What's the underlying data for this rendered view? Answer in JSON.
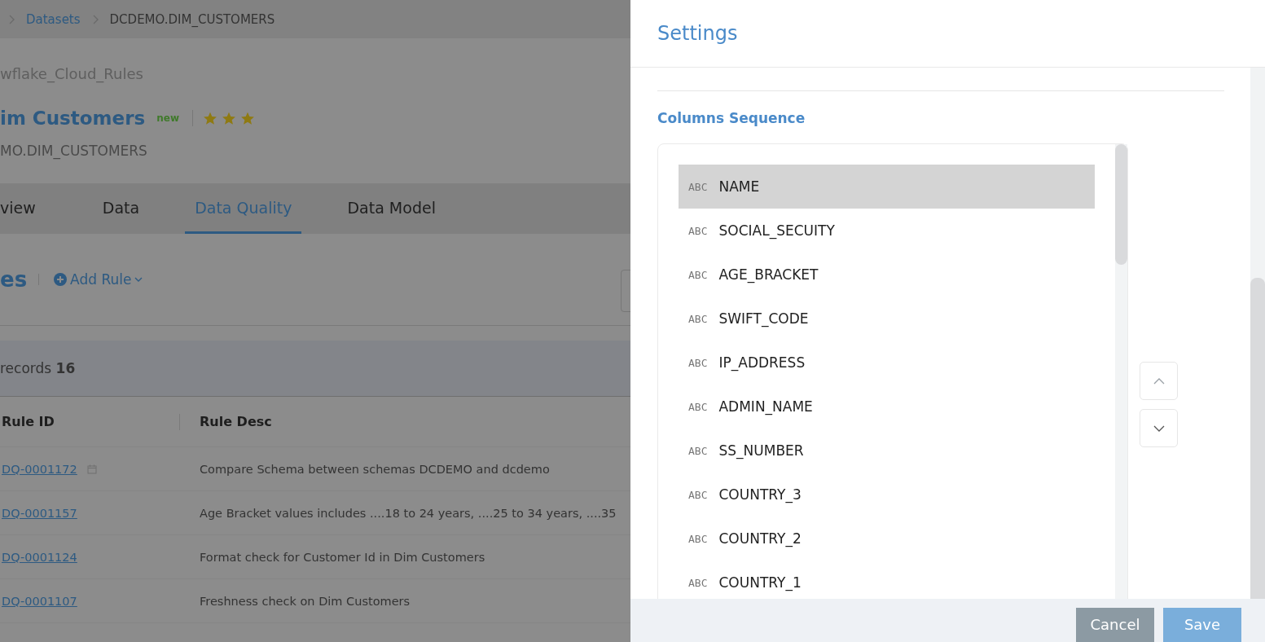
{
  "breadcrumb": [
    {
      "label": "Datasets",
      "link": true
    },
    {
      "label": "DCDEMO.DIM_CUSTOMERS",
      "link": false
    }
  ],
  "header": {
    "source": "wflake_Cloud_Rules",
    "title": "im Customers",
    "badge": "new",
    "stars": 3,
    "subtitle": "MO.DIM_CUSTOMERS"
  },
  "tabs": [
    {
      "label": "view",
      "selected": false
    },
    {
      "label": "Data",
      "selected": false
    },
    {
      "label": "Data Quality",
      "selected": true
    },
    {
      "label": "Data Model",
      "selected": false
    }
  ],
  "rules_bar": {
    "title": "es",
    "add_button": "Add Rule"
  },
  "records": "records **16**",
  "table": {
    "columns": [
      "Rule ID",
      "Rule Desc"
    ],
    "rows": [
      {
        "id": "DQ-0001172",
        "calendar": true,
        "desc": "Compare Schema between schemas DCDEMO and dcdemo"
      },
      {
        "id": "DQ-0001157",
        "calendar": false,
        "desc": "Age Bracket values includes ....18 to 24 years, ....25 to 34 years, ....35"
      },
      {
        "id": "DQ-0001124",
        "calendar": false,
        "desc": "Format check for Customer Id in Dim Customers"
      },
      {
        "id": "DQ-0001107",
        "calendar": false,
        "desc": "Freshness check on Dim Customers"
      }
    ]
  },
  "settings": {
    "title": "Settings",
    "section": "Columns Sequence",
    "columns": [
      {
        "type": "ABC",
        "name": "NAME",
        "selected": true
      },
      {
        "type": "ABC",
        "name": "SOCIAL_SECUITY",
        "selected": false
      },
      {
        "type": "ABC",
        "name": "AGE_BRACKET",
        "selected": false
      },
      {
        "type": "ABC",
        "name": "SWIFT_CODE",
        "selected": false
      },
      {
        "type": "ABC",
        "name": "IP_ADDRESS",
        "selected": false
      },
      {
        "type": "ABC",
        "name": "ADMIN_NAME",
        "selected": false
      },
      {
        "type": "ABC",
        "name": "SS_NUMBER",
        "selected": false
      },
      {
        "type": "ABC",
        "name": "COUNTRY_3",
        "selected": false
      },
      {
        "type": "ABC",
        "name": "COUNTRY_2",
        "selected": false
      },
      {
        "type": "ABC",
        "name": "COUNTRY_1",
        "selected": false
      }
    ],
    "buttons": [
      "Cancel",
      "Save"
    ]
  }
}
